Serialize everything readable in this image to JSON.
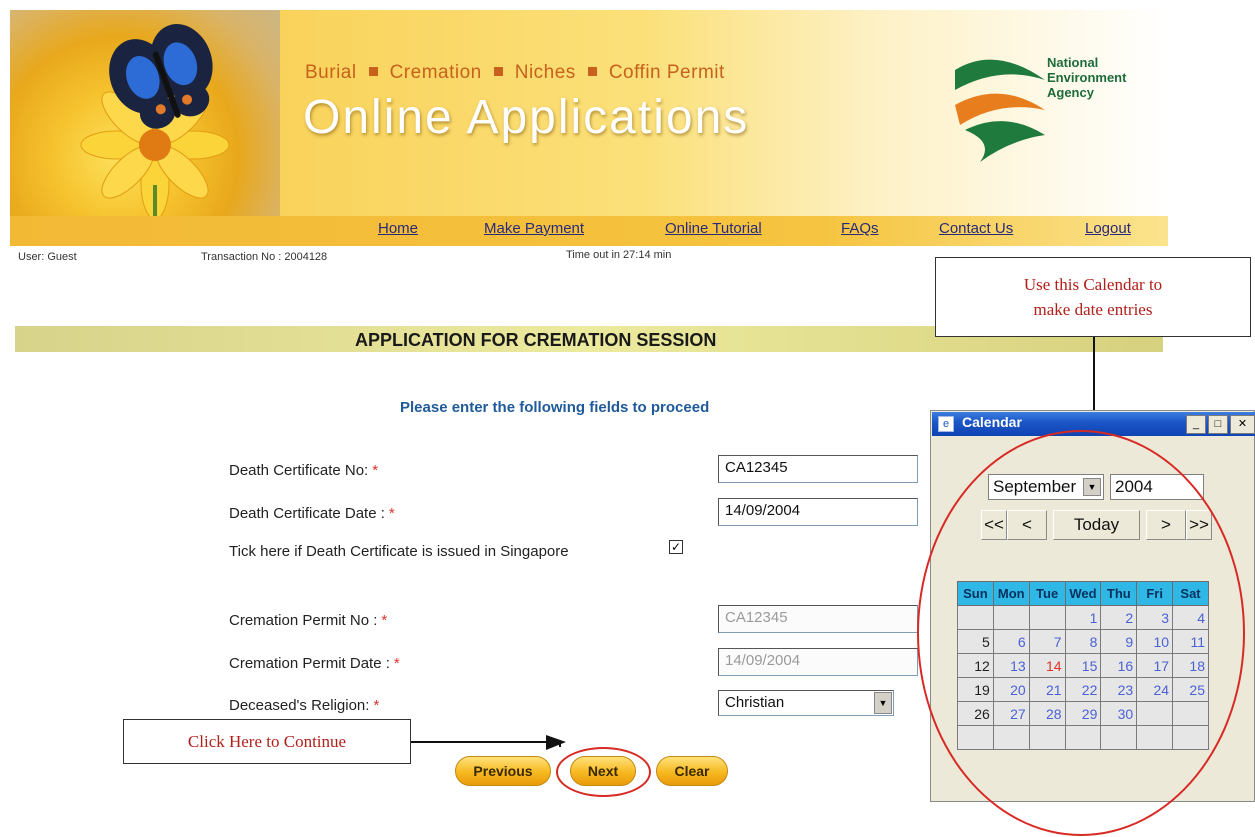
{
  "banner": {
    "subtitle_items": [
      "Burial",
      "Cremation",
      "Niches",
      "Coffin Permit"
    ],
    "title": "Online Applications",
    "org_line1": "National",
    "org_line2": "Environment",
    "org_line3": "Agency"
  },
  "nav": {
    "home": "Home",
    "make_payment": "Make Payment",
    "online_tutorial": "Online Tutorial",
    "faqs": "FAQs",
    "contact_us": "Contact Us",
    "logout": "Logout"
  },
  "session": {
    "user": "User: Guest",
    "transaction": "Transaction No : 2004128",
    "timeout": "Time out in 27:14 min"
  },
  "section_title": "APPLICATION FOR CREMATION SESSION",
  "instruction": "Please enter the following fields to proceed",
  "form": {
    "death_cert_no_label": "Death Certificate No:",
    "death_cert_no_value": "CA12345",
    "death_cert_date_label": "Death Certificate Date :",
    "death_cert_date_value": "14/09/2004",
    "singapore_label": "Tick here if Death Certificate is issued in Singapore",
    "singapore_checked": true,
    "cremation_permit_no_label": "Cremation Permit No :",
    "cremation_permit_no_value": "CA12345",
    "cremation_permit_date_label": "Cremation Permit Date :",
    "cremation_permit_date_value": "14/09/2004",
    "religion_label": "Deceased's Religion:",
    "religion_value": "Christian",
    "required_mark": "*"
  },
  "buttons": {
    "previous": "Previous",
    "next": "Next",
    "clear": "Clear"
  },
  "callouts": {
    "calendar_line1": "Use this Calendar to",
    "calendar_line2": "make date entries",
    "continue": "Click Here to Continue"
  },
  "calendar": {
    "window_title": "Calendar",
    "month": "September",
    "year": "2004",
    "prev_year": "<<",
    "prev_month": "<",
    "today": "Today",
    "next_month": ">",
    "next_year": ">>",
    "weekdays": [
      "Sun",
      "Mon",
      "Tue",
      "Wed",
      "Thu",
      "Fri",
      "Sat"
    ],
    "weeks": [
      [
        "",
        "",
        "",
        "1",
        "2",
        "3",
        "4"
      ],
      [
        "5",
        "6",
        "7",
        "8",
        "9",
        "10",
        "11"
      ],
      [
        "12",
        "13",
        "14",
        "15",
        "16",
        "17",
        "18"
      ],
      [
        "19",
        "20",
        "21",
        "22",
        "23",
        "24",
        "25"
      ],
      [
        "26",
        "27",
        "28",
        "29",
        "30",
        "",
        ""
      ],
      [
        "",
        "",
        "",
        "",
        "",
        "",
        ""
      ]
    ],
    "highlighted_day": "14"
  },
  "colors": {
    "accent_red": "#d82a24",
    "link_blue": "#2a2a7a",
    "banner_gold": "#f6c84a"
  }
}
